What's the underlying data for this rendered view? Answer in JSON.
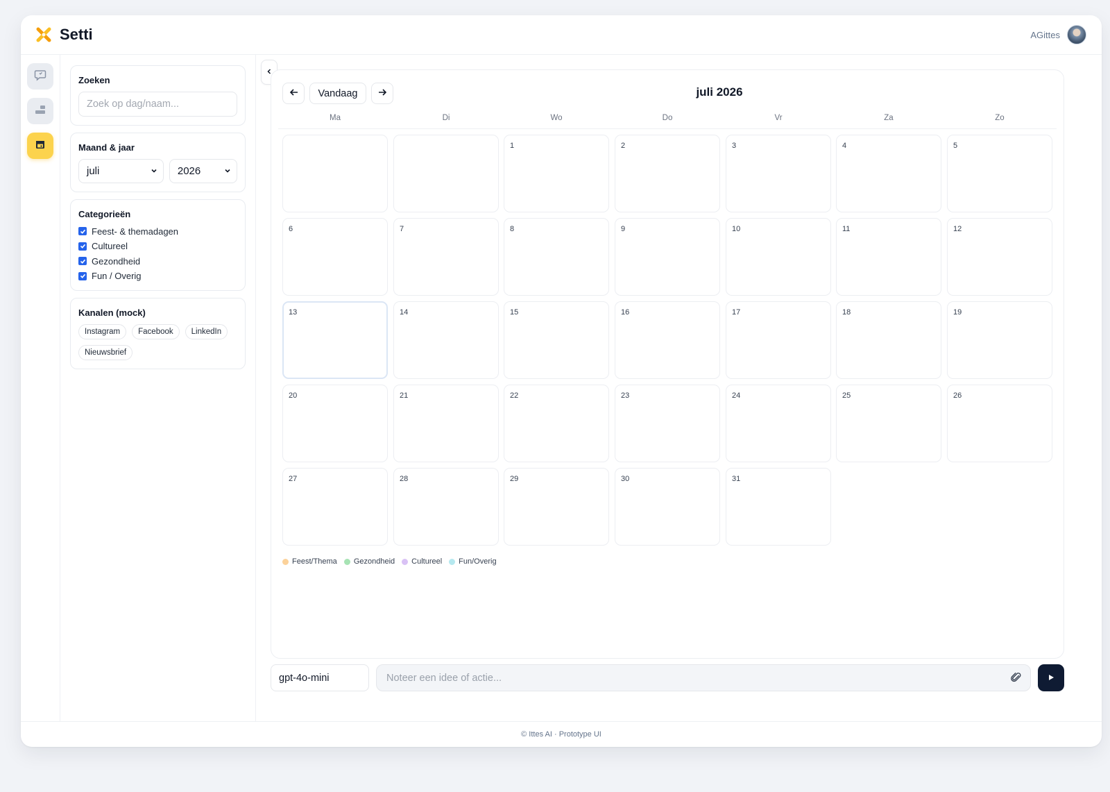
{
  "app": {
    "title": "Setti",
    "user_name": "AGittes"
  },
  "filters": {
    "search": {
      "title": "Zoeken",
      "placeholder": "Zoek op dag/naam..."
    },
    "month_year": {
      "title": "Maand & jaar",
      "month": "juli",
      "year": "2026"
    },
    "categories": {
      "title": "Categorieën",
      "items": [
        {
          "label": "Feest- & themadagen",
          "checked": true
        },
        {
          "label": "Cultureel",
          "checked": true
        },
        {
          "label": "Gezondheid",
          "checked": true
        },
        {
          "label": "Fun / Overig",
          "checked": true
        }
      ]
    },
    "channels": {
      "title": "Kanalen (mock)",
      "items": [
        "Instagram",
        "Facebook",
        "LinkedIn",
        "Nieuwsbrief"
      ]
    }
  },
  "calendar": {
    "prev_icon": "arrow-left-icon",
    "today_label": "Vandaag",
    "next_icon": "arrow-right-icon",
    "month_title": "juli 2026",
    "weekdays": [
      "Ma",
      "Di",
      "Wo",
      "Do",
      "Vr",
      "Za",
      "Zo"
    ],
    "days": [
      "1",
      "2",
      "3",
      "4",
      "5",
      "6",
      "7",
      "8",
      "9",
      "10",
      "11",
      "12",
      "13",
      "14",
      "15",
      "16",
      "17",
      "18",
      "19",
      "20",
      "21",
      "22",
      "23",
      "24",
      "25",
      "26",
      "27",
      "28",
      "29",
      "30",
      "31"
    ],
    "leading_blank_days": 2,
    "today": "13",
    "legend": [
      {
        "label": "Feest/Thema",
        "color": "#fcd29a"
      },
      {
        "label": "Gezondheid",
        "color": "#a7e3b4"
      },
      {
        "label": "Cultureel",
        "color": "#d9c2f5"
      },
      {
        "label": "Fun/Overig",
        "color": "#b5e8ef"
      }
    ]
  },
  "composer": {
    "model": "gpt-4o-mini",
    "placeholder": "Noteer een idee of actie..."
  },
  "footer": {
    "text": "© Ittes AI · Prototype UI"
  }
}
